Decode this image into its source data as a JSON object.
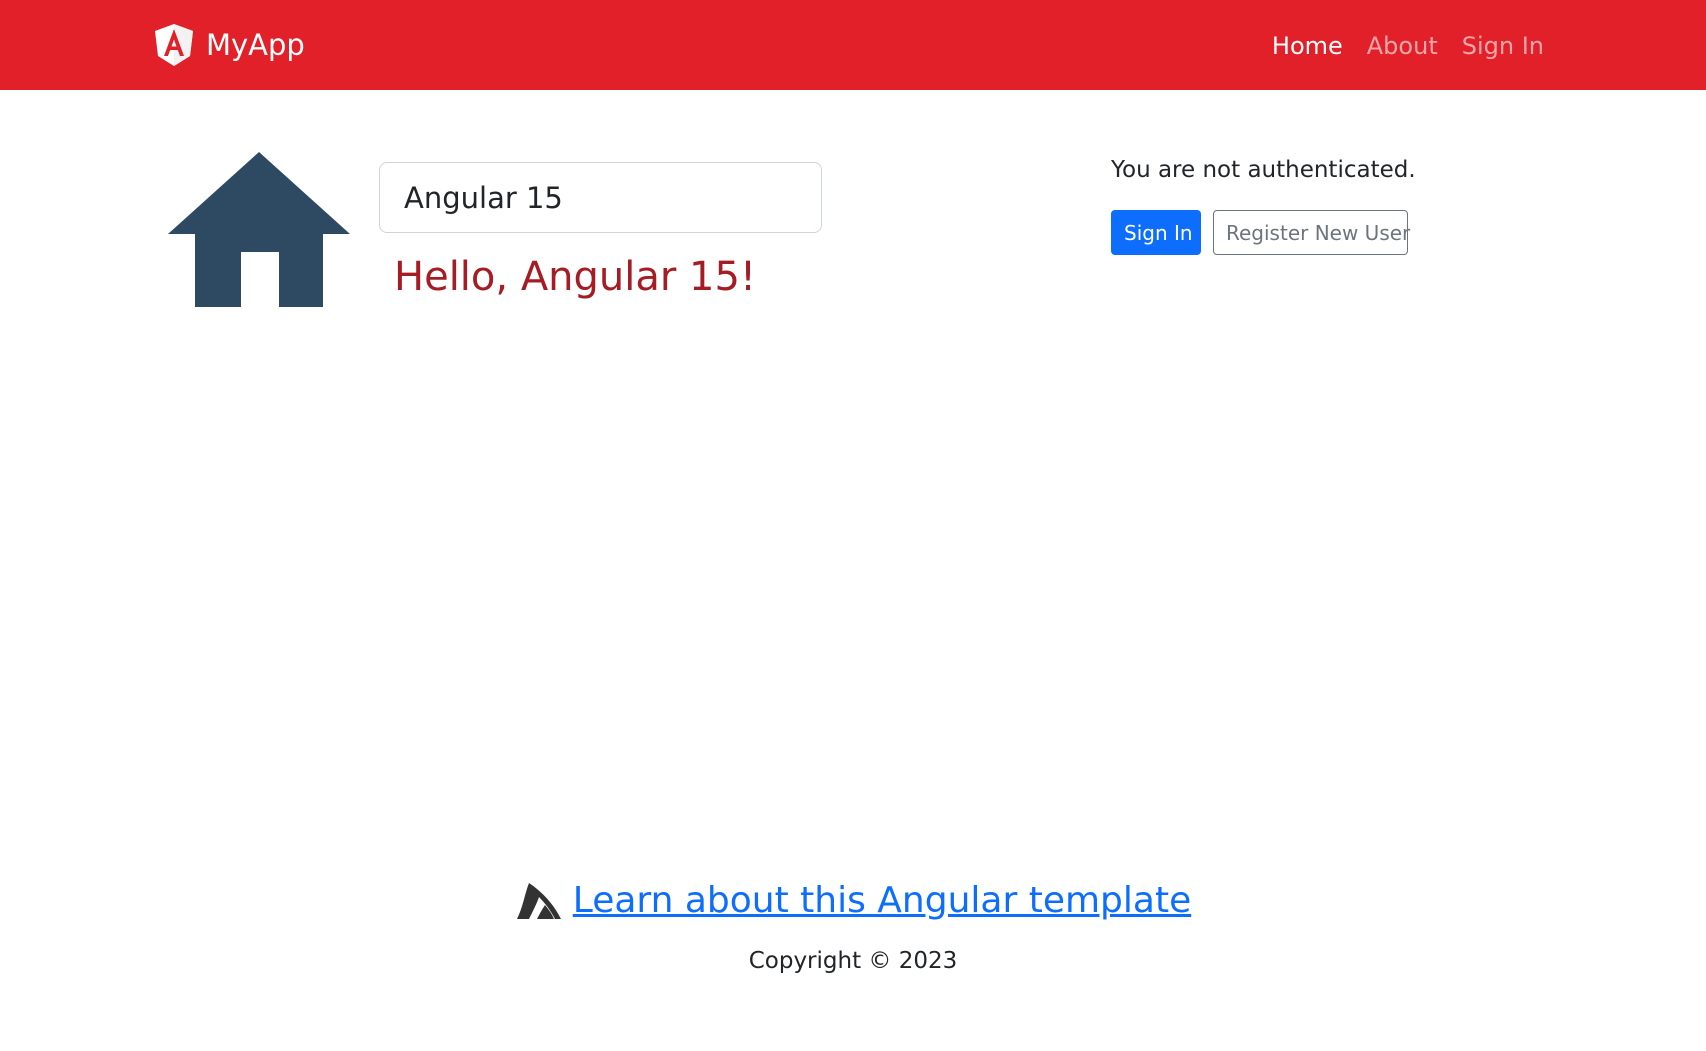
{
  "navbar": {
    "brand": "MyApp",
    "brand_icon": "angular-logo-icon",
    "background": "#e12029",
    "links": [
      {
        "label": "Home",
        "active": true
      },
      {
        "label": "About",
        "active": false
      },
      {
        "label": "Sign In",
        "active": false
      }
    ]
  },
  "main": {
    "hero_icon": "house-icon",
    "name_input": {
      "value": "Angular 15"
    },
    "greeting": "Hello, Angular 15!",
    "greeting_color": "#a61c24"
  },
  "auth": {
    "status_text": "You are not authenticated.",
    "sign_in_label": "Sign In",
    "register_label": "Register New User",
    "primary_color": "#0d6efd"
  },
  "footer": {
    "link_icon": "shark-fin-icon",
    "link_text": "Learn about this Angular template",
    "copyright": "Copyright © 2023"
  }
}
